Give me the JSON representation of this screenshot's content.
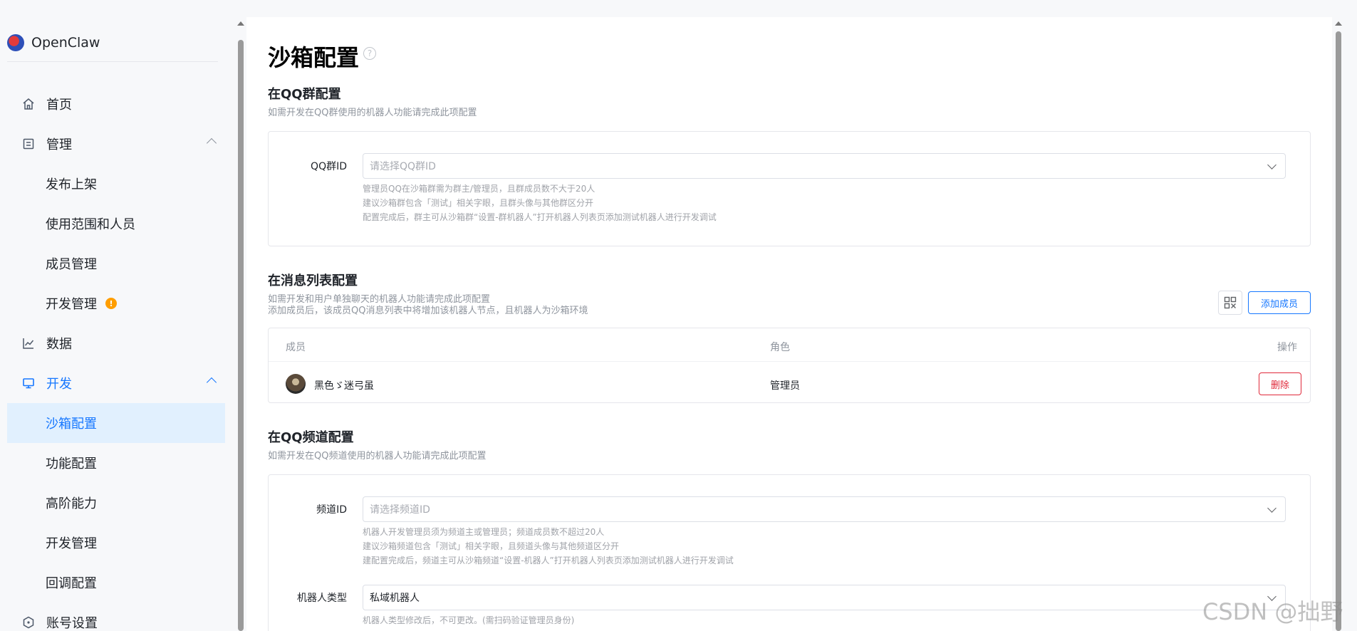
{
  "brand": {
    "name": "OpenClaw"
  },
  "sidebar": {
    "items": [
      {
        "label": "首页",
        "icon": "home-icon"
      },
      {
        "label": "管理",
        "icon": "document-icon",
        "expanded": true,
        "children": [
          "发布上架",
          "使用范围和人员",
          "成员管理",
          "开发管理"
        ]
      },
      {
        "label": "数据",
        "icon": "chart-icon"
      },
      {
        "label": "开发",
        "icon": "monitor-icon",
        "expanded": true,
        "active": true,
        "children": [
          "沙箱配置",
          "功能配置",
          "高阶能力",
          "开发管理",
          "回调配置"
        ]
      },
      {
        "label": "账号设置",
        "icon": "settings-hexagon-icon"
      }
    ],
    "warning_badge": "!",
    "active_item": "沙箱配置"
  },
  "page": {
    "title": "沙箱配置",
    "help_icon": "question-circle-icon"
  },
  "qq_group": {
    "title": "在QQ群配置",
    "desc": "如需开发在QQ群使用的机器人功能请完成此项配置",
    "field_label": "QQ群ID",
    "placeholder": "请选择QQ群ID",
    "hints": [
      "管理员QQ在沙箱群需为群主/管理员，且群成员数不大于20人",
      "建议沙箱群包含「测试」相关字眼，且群头像与其他群区分开",
      "配置完成后，群主可从沙箱群“设置-群机器人”打开机器人列表页添加测试机器人进行开发调试"
    ]
  },
  "message_list": {
    "title": "在消息列表配置",
    "desc_lines": [
      "如需开发和用户单独聊天的机器人功能请完成此项配置",
      "添加成员后，该成员QQ消息列表中将增加该机器人节点，且机器人为沙箱环境"
    ],
    "add_button": "添加成员",
    "qr_icon": "qrcode-icon",
    "columns": [
      "成员",
      "角色",
      "操作"
    ],
    "rows": [
      {
        "member": "黑色ゞ迷弓虽",
        "role": "管理员",
        "action": "删除"
      }
    ]
  },
  "channel": {
    "title": "在QQ频道配置",
    "desc": "如需开发在QQ频道使用的机器人功能请完成此项配置",
    "field_label": "频道ID",
    "placeholder": "请选择频道ID",
    "hints": [
      "机器人开发管理员须为频道主或管理员；频道成员数不超过20人",
      "建议沙箱频道包含「测试」相关字眼，且频道头像与其他频道区分开",
      "建配置完成后，频道主可从沙箱频道“设置-机器人”打开机器人列表页添加测试机器人进行开发调试"
    ],
    "bot_type_label": "机器人类型",
    "bot_type_value": "私域机器人",
    "bot_type_hint": "机器人类型修改后，不可更改。(需扫码验证管理员身份)"
  },
  "watermark": "CSDN @拙野",
  "colors": {
    "accent": "#1677ff",
    "danger": "#e0293a",
    "warning": "#ff9e00",
    "active_bg": "#e1f0fe"
  }
}
